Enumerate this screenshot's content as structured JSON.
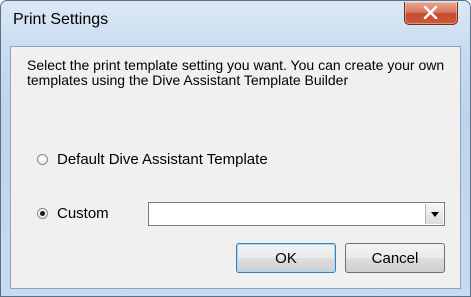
{
  "window": {
    "title": "Print Settings"
  },
  "dialog": {
    "description": "Select the print template setting you want.  You can create your own templates using the Dive Assistant Template Builder",
    "options": [
      {
        "label": "Default Dive Assistant Template",
        "checked": false
      },
      {
        "label": "Custom",
        "checked": true
      }
    ],
    "custom_template_value": "",
    "ok_label": "OK",
    "cancel_label": "Cancel"
  },
  "icons": {
    "close": "close-icon",
    "combo_arrow": "chevron-down-icon"
  },
  "colors": {
    "close_button": "#c44a2c",
    "frame": "#bfd4ea",
    "client_background": "#f0f0f0"
  }
}
